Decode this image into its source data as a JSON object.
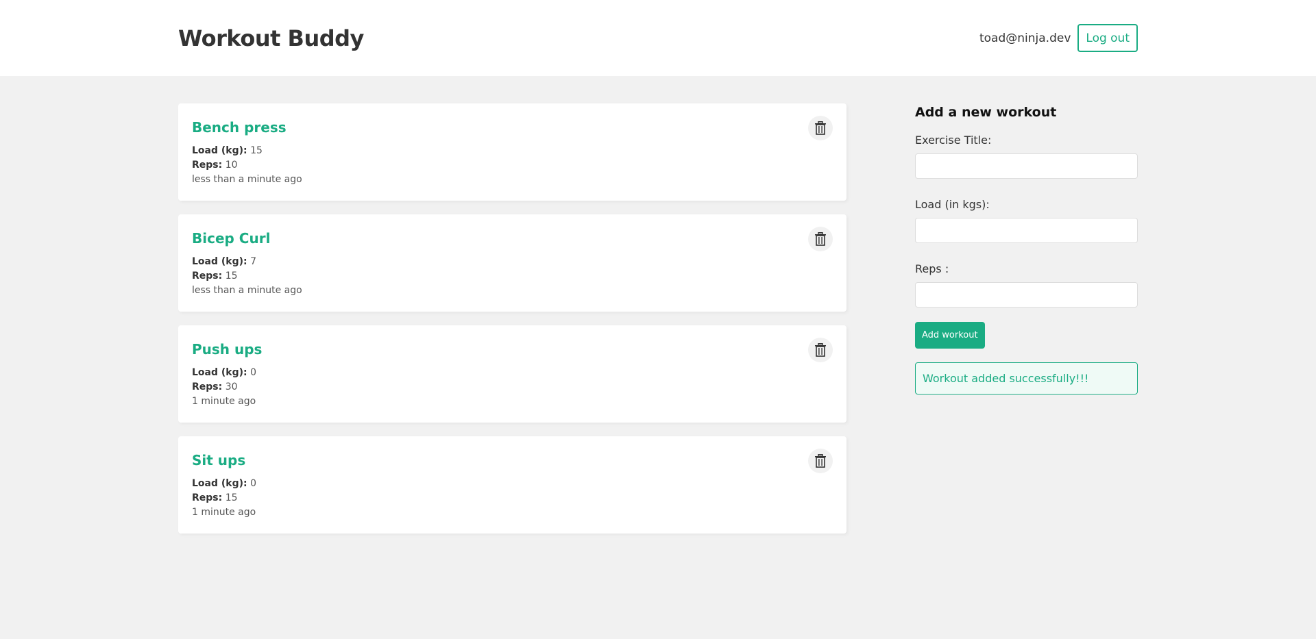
{
  "header": {
    "logo": "Workout Buddy",
    "user_email": "toad@ninja.dev",
    "logout_label": "Log out"
  },
  "workouts": [
    {
      "title": "Bench press",
      "load_label": "Load (kg):",
      "load": "15",
      "reps_label": "Reps:",
      "reps": "10",
      "time": "less than a minute ago"
    },
    {
      "title": "Bicep Curl",
      "load_label": "Load (kg):",
      "load": "7",
      "reps_label": "Reps:",
      "reps": "15",
      "time": "less than a minute ago"
    },
    {
      "title": "Push ups",
      "load_label": "Load (kg):",
      "load": "0",
      "reps_label": "Reps:",
      "reps": "30",
      "time": "1 minute ago"
    },
    {
      "title": "Sit ups",
      "load_label": "Load (kg):",
      "load": "0",
      "reps_label": "Reps:",
      "reps": "15",
      "time": "1 minute ago"
    }
  ],
  "form": {
    "title": "Add a new workout",
    "title_label": "Exercise Title:",
    "title_value": "",
    "load_label": "Load (in kgs):",
    "load_value": "",
    "reps_label": "Reps :",
    "reps_value": "",
    "submit_label": "Add workout",
    "success_message": "Workout added successfully!!!"
  },
  "colors": {
    "primary": "#1aac83",
    "background": "#f1f1f1",
    "success_bg": "#effaf6"
  },
  "icons": {
    "delete": "trash-icon"
  }
}
